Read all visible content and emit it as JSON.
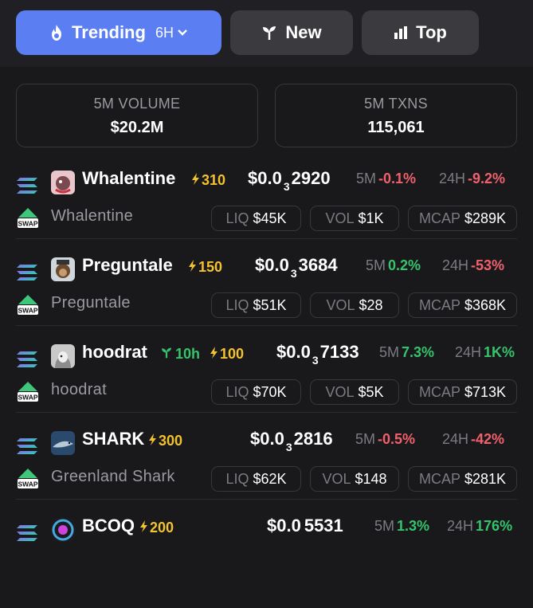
{
  "tabs": {
    "trending": {
      "label": "Trending",
      "period": "6H"
    },
    "new": {
      "label": "New"
    },
    "top": {
      "label": "Top"
    }
  },
  "stats": [
    {
      "label": "5M VOLUME",
      "value": "$20.2M"
    },
    {
      "label": "5M TXNS",
      "value": "115,061"
    }
  ],
  "labels": {
    "m5": "5M",
    "h24": "24H",
    "liq": "LIQ",
    "vol": "VOL",
    "mcap": "MCAP"
  },
  "tokens": [
    {
      "name": "Whalentine",
      "sub": "Whalentine",
      "boost": "310",
      "age": "",
      "price_pre": "$0.0",
      "price_zeros": "3",
      "price_post": "2920",
      "m5": "-0.1%",
      "m5_dir": "neg",
      "h24": "-9.2%",
      "h24_dir": "neg",
      "liq": "$45K",
      "vol": "$1K",
      "mcap": "$289K",
      "avatar": "whale-avatar"
    },
    {
      "name": "Preguntale",
      "sub": "Preguntale",
      "boost": "150",
      "age": "",
      "price_pre": "$0.0",
      "price_zeros": "3",
      "price_post": "3684",
      "m5": "0.2%",
      "m5_dir": "pos",
      "h24": "-53%",
      "h24_dir": "neg",
      "liq": "$51K",
      "vol": "$28",
      "mcap": "$368K",
      "avatar": "monkey-avatar"
    },
    {
      "name": "hoodrat",
      "sub": "hoodrat",
      "boost": "100",
      "age": "10h",
      "price_pre": "$0.0",
      "price_zeros": "3",
      "price_post": "7133",
      "m5": "7.3%",
      "m5_dir": "pos",
      "h24": "1K%",
      "h24_dir": "pos",
      "liq": "$70K",
      "vol": "$5K",
      "mcap": "$713K",
      "avatar": "hood-avatar"
    },
    {
      "name": "SHARK",
      "sub": "Greenland Shark",
      "boost": "300",
      "age": "",
      "price_pre": "$0.0",
      "price_zeros": "3",
      "price_post": "2816",
      "m5": "-0.5%",
      "m5_dir": "neg",
      "h24": "-42%",
      "h24_dir": "neg",
      "liq": "$62K",
      "vol": "$148",
      "mcap": "$281K",
      "avatar": "shark-avatar"
    },
    {
      "name": "BCOQ",
      "sub": "",
      "boost": "200",
      "age": "",
      "price_pre": "$0.0",
      "price_zeros": "",
      "price_post": "5531",
      "m5": "1.3%",
      "m5_dir": "pos",
      "h24": "176%",
      "h24_dir": "pos",
      "liq": "",
      "vol": "",
      "mcap": "",
      "avatar": "bcoq-avatar"
    }
  ],
  "colors": {
    "accent": "#5b7ff3",
    "boost": "#f2c230",
    "positive": "#36c36b",
    "negative": "#f0616c"
  }
}
